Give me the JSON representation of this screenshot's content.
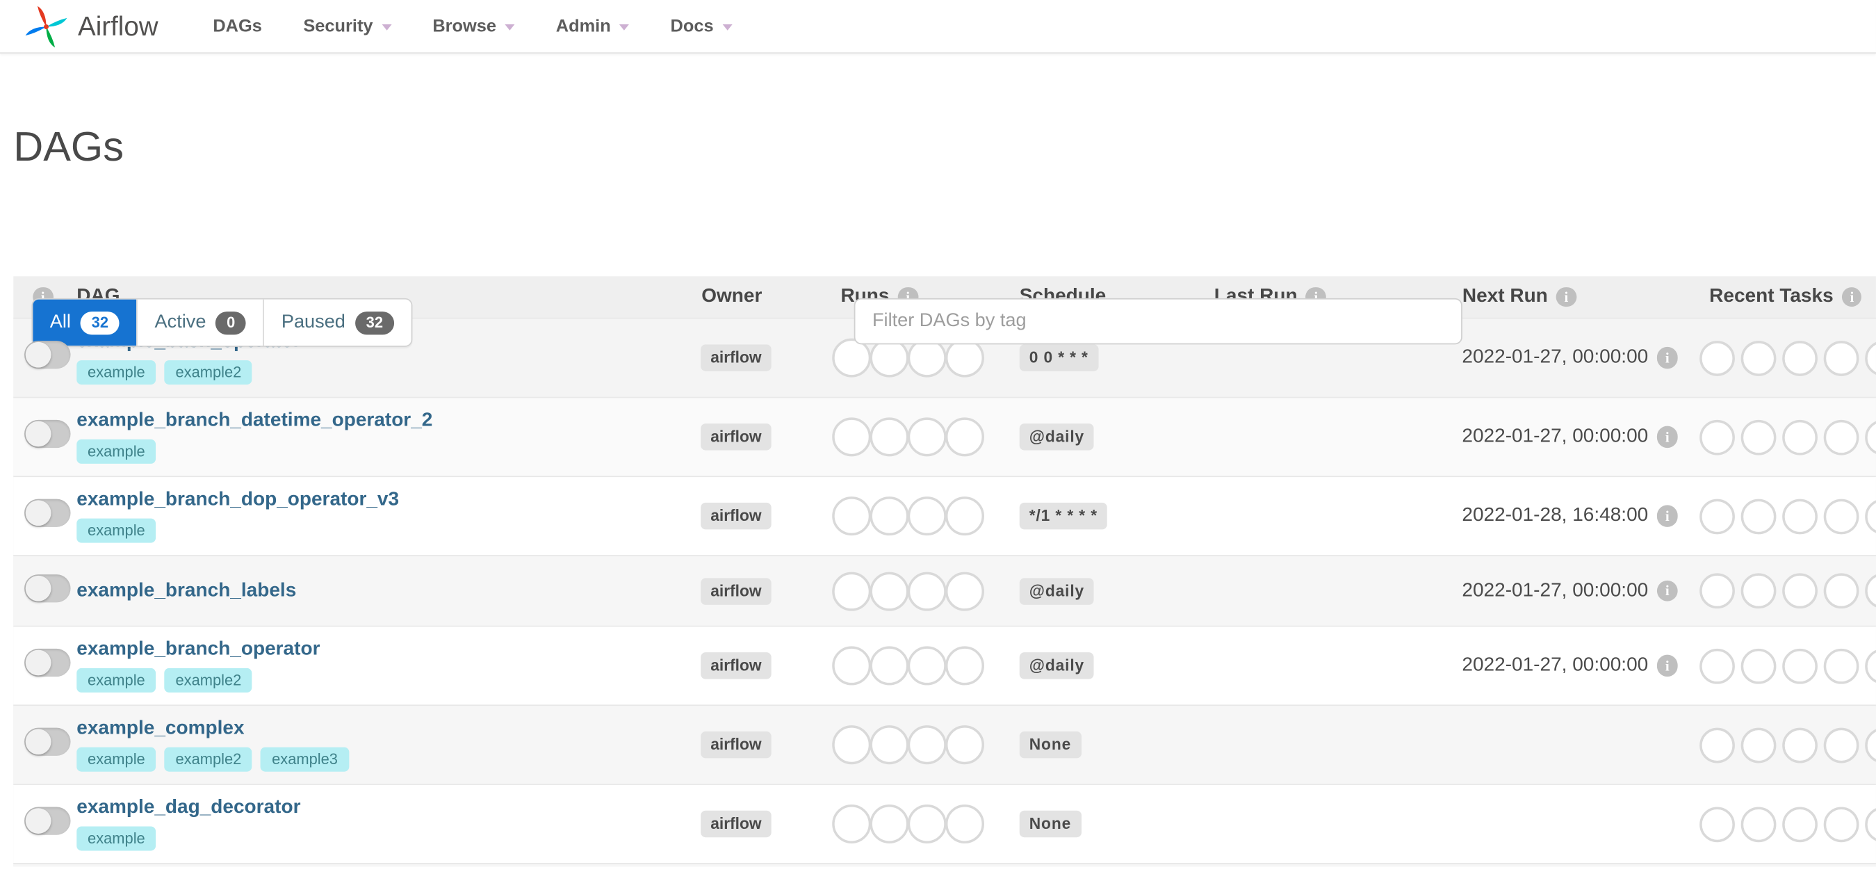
{
  "brand": {
    "name": "Airflow"
  },
  "nav": {
    "items": [
      {
        "label": "DAGs",
        "has_dropdown": false
      },
      {
        "label": "Security",
        "has_dropdown": true
      },
      {
        "label": "Browse",
        "has_dropdown": true
      },
      {
        "label": "Admin",
        "has_dropdown": true
      },
      {
        "label": "Docs",
        "has_dropdown": true
      }
    ]
  },
  "page": {
    "title": "DAGs"
  },
  "tabs": {
    "items": [
      {
        "label": "All",
        "count": "32",
        "active": true
      },
      {
        "label": "Active",
        "count": "0",
        "active": false
      },
      {
        "label": "Paused",
        "count": "32",
        "active": false
      }
    ]
  },
  "filter": {
    "placeholder": "Filter DAGs by tag",
    "value": ""
  },
  "table": {
    "header": [
      {
        "label": "",
        "info": true
      },
      {
        "label": "DAG",
        "info": false
      },
      {
        "label": "Owner",
        "info": false
      },
      {
        "label": "Runs",
        "info": true
      },
      {
        "label": "Schedule",
        "info": false
      },
      {
        "label": "Last Run",
        "info": true
      },
      {
        "label": "Next Run",
        "info": true
      },
      {
        "label": "Recent Tasks",
        "info": true
      }
    ],
    "runs_slots": 4,
    "recent_task_slots": 5,
    "rows": [
      {
        "name": "example_bash_operator",
        "tags": [
          "example",
          "example2"
        ],
        "owner": "airflow",
        "schedule": "0 0 * * *",
        "last_run": "",
        "next_run": "2022-01-27, 00:00:00",
        "paused": true
      },
      {
        "name": "example_branch_datetime_operator_2",
        "tags": [
          "example"
        ],
        "owner": "airflow",
        "schedule": "@daily",
        "last_run": "",
        "next_run": "2022-01-27, 00:00:00",
        "paused": true
      },
      {
        "name": "example_branch_dop_operator_v3",
        "tags": [
          "example"
        ],
        "owner": "airflow",
        "schedule": "*/1 * * * *",
        "last_run": "",
        "next_run": "2022-01-28, 16:48:00",
        "paused": true
      },
      {
        "name": "example_branch_labels",
        "tags": [],
        "owner": "airflow",
        "schedule": "@daily",
        "last_run": "",
        "next_run": "2022-01-27, 00:00:00",
        "paused": true
      },
      {
        "name": "example_branch_operator",
        "tags": [
          "example",
          "example2"
        ],
        "owner": "airflow",
        "schedule": "@daily",
        "last_run": "",
        "next_run": "2022-01-27, 00:00:00",
        "paused": true
      },
      {
        "name": "example_complex",
        "tags": [
          "example",
          "example2",
          "example3"
        ],
        "owner": "airflow",
        "schedule": "None",
        "last_run": "",
        "next_run": "",
        "paused": true
      },
      {
        "name": "example_dag_decorator",
        "tags": [
          "example"
        ],
        "owner": "airflow",
        "schedule": "None",
        "last_run": "",
        "next_run": "",
        "paused": true
      }
    ]
  },
  "colors": {
    "accent_blue": "#1673d1",
    "dag_link_blue": "#33678a",
    "tag_bg": "#b5eef3",
    "tag_text": "#3f828a",
    "badge_bg": "#e3e3e3",
    "panel_bg": "#efefef",
    "logo_red": "#e43921",
    "logo_cyan": "#00c7d4",
    "logo_green": "#00ad46",
    "logo_blue": "#017cee"
  }
}
